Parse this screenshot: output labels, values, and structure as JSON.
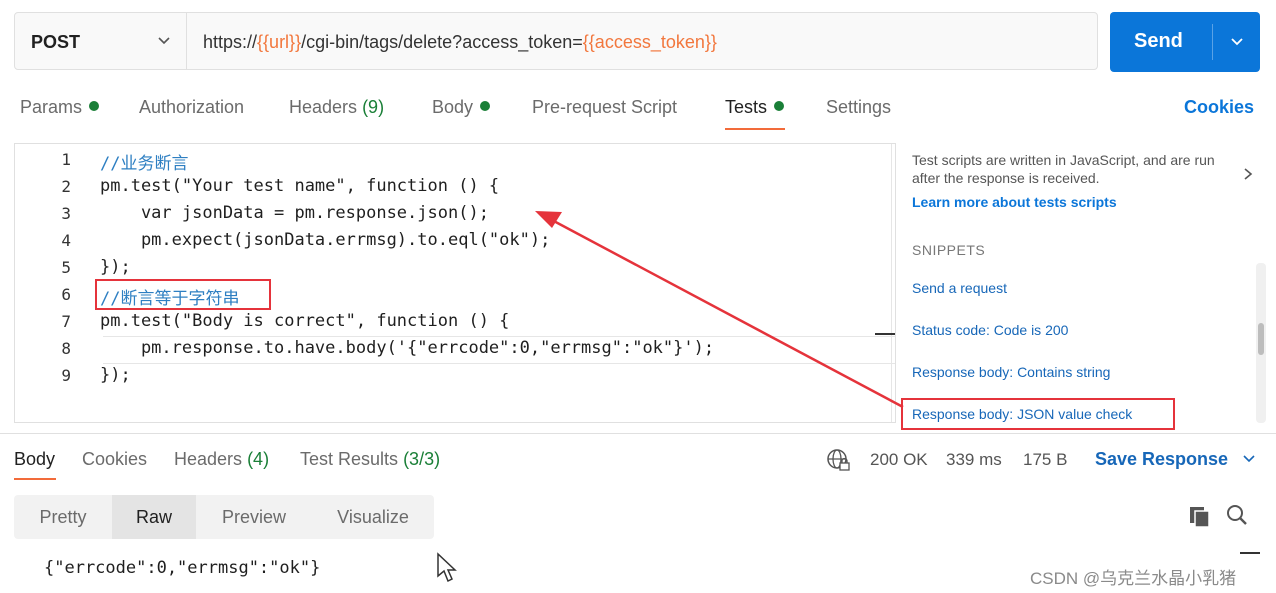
{
  "request": {
    "method": "POST",
    "url_parts": [
      "https://",
      "{{url}}",
      "/cgi-bin/tags/delete?access_token=",
      "{{access_token}}"
    ],
    "send_label": "Send"
  },
  "tabs": [
    {
      "label": "Params",
      "dot": true
    },
    {
      "label": "Authorization"
    },
    {
      "label": "Headers",
      "count": "(9)"
    },
    {
      "label": "Body",
      "dot": true
    },
    {
      "label": "Pre-request Script"
    },
    {
      "label": "Tests",
      "dot": true,
      "active": true
    },
    {
      "label": "Settings"
    }
  ],
  "cookies_link": "Cookies",
  "editor": {
    "line_numbers": [
      "1",
      "2",
      "3",
      "4",
      "5",
      "6",
      "7",
      "8",
      "9"
    ],
    "lines": [
      "//业务断言",
      "pm.test(\"Your test name\", function () {",
      "    var jsonData = pm.response.json();",
      "    pm.expect(jsonData.errmsg).to.eql(\"ok\");",
      "});",
      "//断言等于字符串",
      "pm.test(\"Body is correct\", function () {",
      "    pm.response.to.have.body('{\"errcode\":0,\"errmsg\":\"ok\"}');",
      "});"
    ]
  },
  "side_panel": {
    "description": "Test scripts are written in JavaScript, and are run after the response is received.",
    "learn_more": "Learn more about tests scripts",
    "snippets_heading": "SNIPPETS",
    "snippets": [
      "Send a request",
      "Status code: Code is 200",
      "Response body: Contains string",
      "Response body: JSON value check"
    ]
  },
  "response": {
    "tabs": [
      {
        "label": "Body",
        "active": true
      },
      {
        "label": "Cookies"
      },
      {
        "label": "Headers",
        "count": "(4)"
      },
      {
        "label": "Test Results",
        "count": "(3/3)"
      }
    ],
    "status": "200 OK",
    "time": "339 ms",
    "size": "175 B",
    "save_label": "Save Response",
    "view_modes": [
      "Pretty",
      "Raw",
      "Preview",
      "Visualize"
    ],
    "active_view": "Raw",
    "body": "{\"errcode\":0,\"errmsg\":\"ok\"}"
  },
  "watermark": "CSDN @乌克兰水晶小乳猪",
  "colors": {
    "accent_blue": "#0b76d9",
    "variable_orange": "#f2773d",
    "status_green": "#1a7f37",
    "tab_underline": "#f26b3a",
    "annotation_red": "#e5333b"
  }
}
